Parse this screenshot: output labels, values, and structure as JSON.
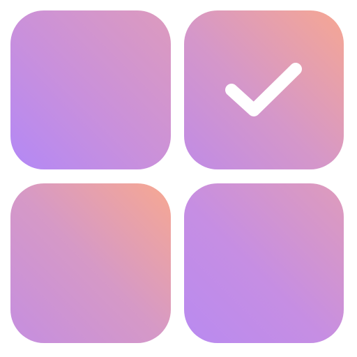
{
  "icon": {
    "name": "checklist-grid-icon",
    "tiles": [
      {
        "name": "tile-top-left",
        "checked": false
      },
      {
        "name": "tile-top-right",
        "checked": true
      },
      {
        "name": "tile-bottom-left",
        "checked": false
      },
      {
        "name": "tile-bottom-right",
        "checked": false
      }
    ],
    "colors": {
      "purple": "#b388f6",
      "pink": "#d597c9",
      "peach": "#f6a792",
      "checkmark": "#ffffff",
      "background": "#ffffff"
    }
  }
}
